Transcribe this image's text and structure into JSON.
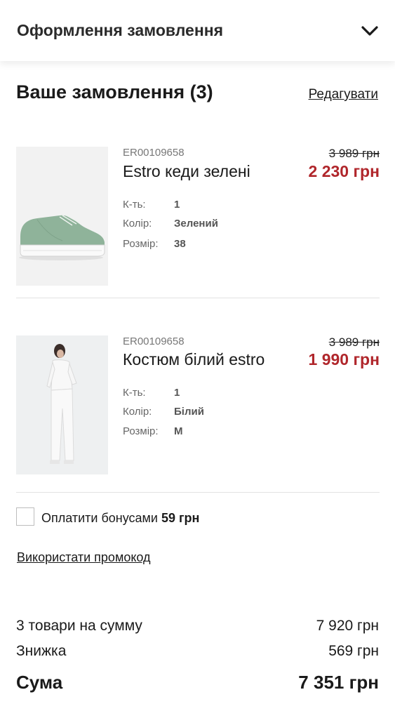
{
  "header": {
    "title": "Оформлення замовлення"
  },
  "order": {
    "title": "Ваше замовлення (3)",
    "edit_label": "Редагувати"
  },
  "items": [
    {
      "sku": "ER00109658",
      "name": "Estro кеди зелені",
      "old_price": "3 989 грн",
      "price": "2 230 грн",
      "attrs": [
        {
          "label": "К-ть:",
          "value": "1"
        },
        {
          "label": "Колір:",
          "value": "Зелений"
        },
        {
          "label": "Розмір:",
          "value": "38"
        }
      ]
    },
    {
      "sku": "ER00109658",
      "name": "Костюм білий estro",
      "old_price": "3 989 грн",
      "price": "1 990 грн",
      "attrs": [
        {
          "label": "К-ть:",
          "value": "1"
        },
        {
          "label": "Колір:",
          "value": "Білий"
        },
        {
          "label": "Розмір:",
          "value": "M"
        }
      ]
    }
  ],
  "bonus": {
    "label": "Оплатити бонусами",
    "amount": "59 грн"
  },
  "promo": {
    "label": "Використати промокод"
  },
  "summary": {
    "goods_label": "3 товари на сумму",
    "goods_value": "7 920 грн",
    "discount_label": "Знижка",
    "discount_value": "569 грн",
    "total_label": "Сума",
    "total_value": "7 351 грн"
  },
  "colors": {
    "price_red": "#b0262b",
    "shoe_green": "#8fb39a"
  }
}
